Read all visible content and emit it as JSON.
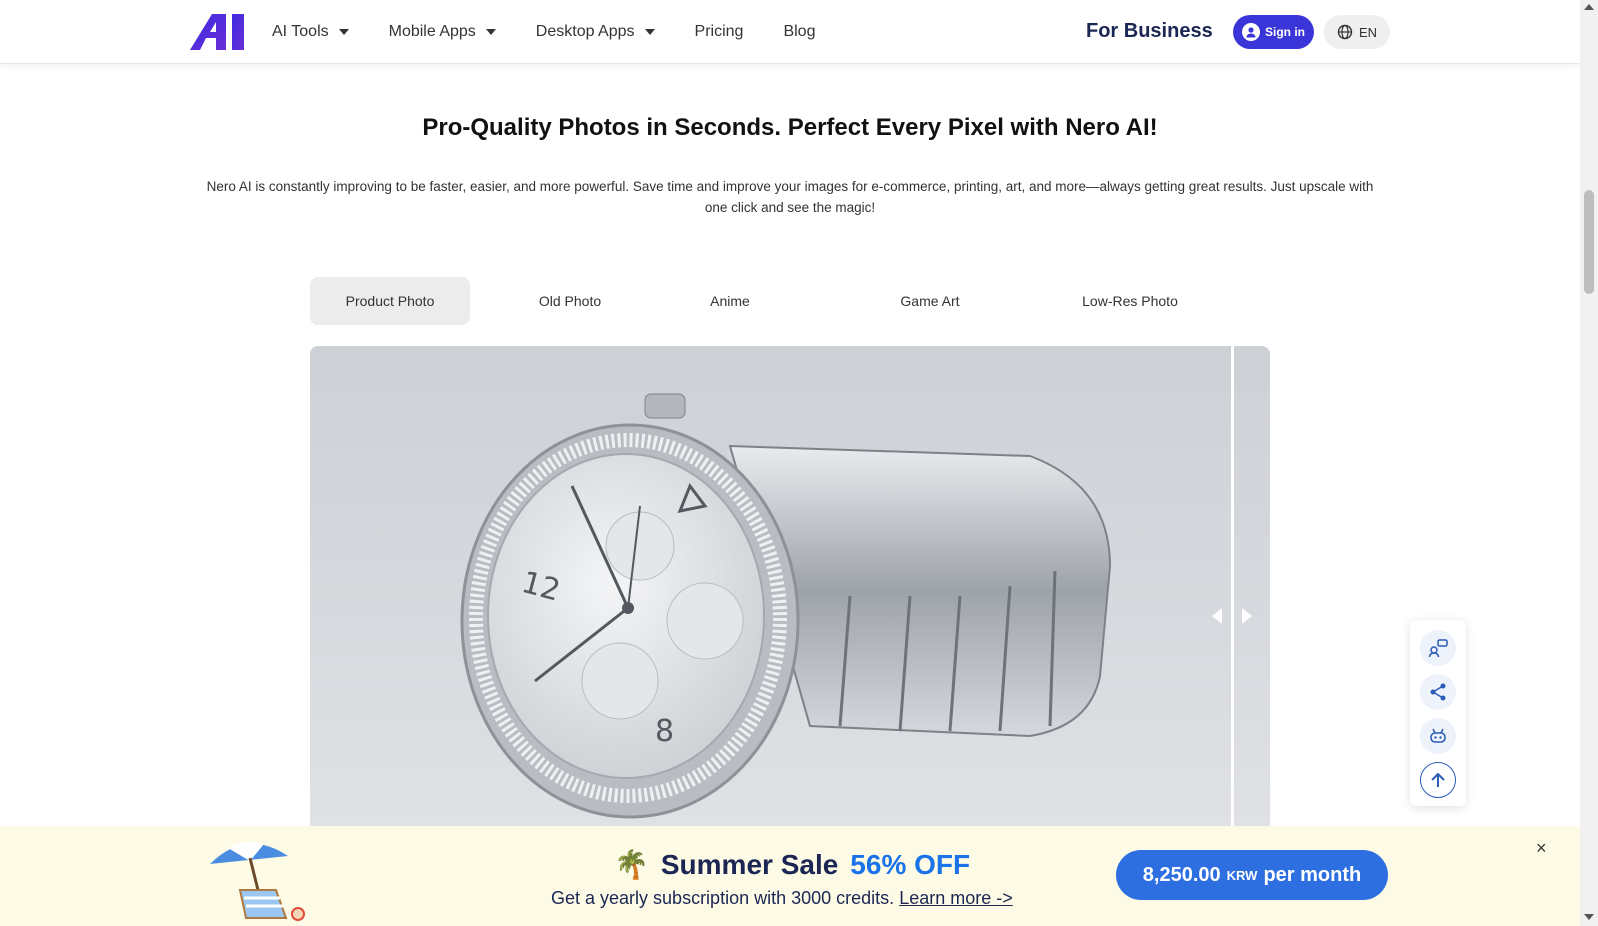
{
  "header": {
    "nav": [
      {
        "label": "AI Tools",
        "dropdown": true
      },
      {
        "label": "Mobile Apps",
        "dropdown": true
      },
      {
        "label": "Desktop Apps",
        "dropdown": true
      },
      {
        "label": "Pricing",
        "dropdown": false
      },
      {
        "label": "Blog",
        "dropdown": false
      }
    ],
    "for_business": "For Business",
    "sign_in": "Sign in",
    "language": "EN"
  },
  "main": {
    "headline": "Pro-Quality Photos in Seconds. Perfect Every Pixel with Nero AI!",
    "description": "Nero AI is constantly improving to be faster, easier, and more powerful. Save time and improve your images for e-commerce, printing, art, and more—always getting great results. Just upscale with one click and see the magic!",
    "tabs": [
      {
        "label": "Product Photo",
        "active": true
      },
      {
        "label": "Old Photo",
        "active": false
      },
      {
        "label": "Anime",
        "active": false
      },
      {
        "label": "Game Art",
        "active": false
      },
      {
        "label": "Low-Res Photo",
        "active": false
      }
    ]
  },
  "side_tools": [
    "feedback-icon",
    "share-icon",
    "android-icon",
    "arrow-up-icon"
  ],
  "banner": {
    "emoji": "🌴",
    "title": "Summer Sale",
    "discount": "56% OFF",
    "subtitle": "Get a yearly subscription with 3000 credits.",
    "link": "Learn more ->",
    "price": "8,250.00",
    "currency": "KRW",
    "period": "per month",
    "close": "×"
  },
  "colors": {
    "brand": "#3a35d8",
    "sale_blue": "#2d6fe0",
    "navy": "#1b2654"
  }
}
